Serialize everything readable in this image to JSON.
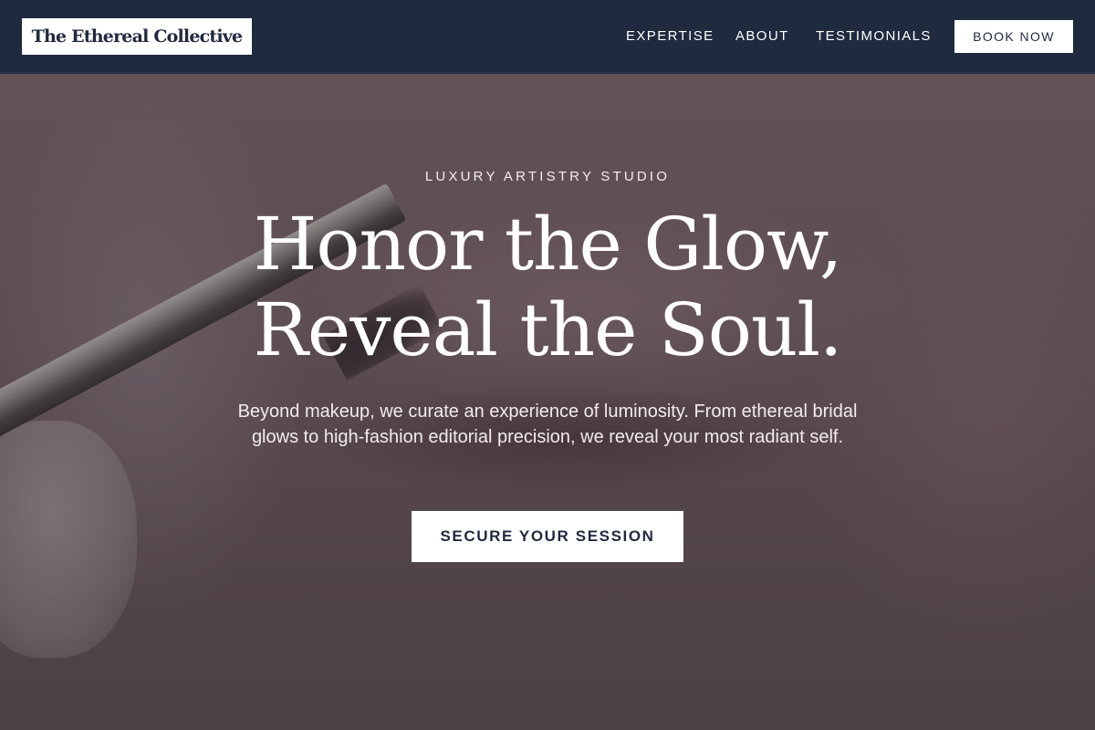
{
  "header": {
    "logo_text": "The Ethereal Collective",
    "nav": [
      {
        "label": "EXPERTISE"
      },
      {
        "label": "ABOUT"
      },
      {
        "label": "TESTIMONIALS"
      }
    ],
    "book_label": "BOOK NOW"
  },
  "hero": {
    "eyebrow": "LUXURY ARTISTRY STUDIO",
    "headline_line1": "Honor the Glow,",
    "headline_line2": "Reveal the Soul.",
    "subtext": "Beyond makeup, we curate an experience of luminosity. From ethereal bridal glows to high-fashion editorial precision, we reveal your most radiant self.",
    "cta_label": "SECURE YOUR SESSION"
  },
  "colors": {
    "header_bg": "#1f2a3f",
    "button_bg": "#ffffff",
    "button_text": "#1f2a3f",
    "hero_text": "#ffffff"
  }
}
